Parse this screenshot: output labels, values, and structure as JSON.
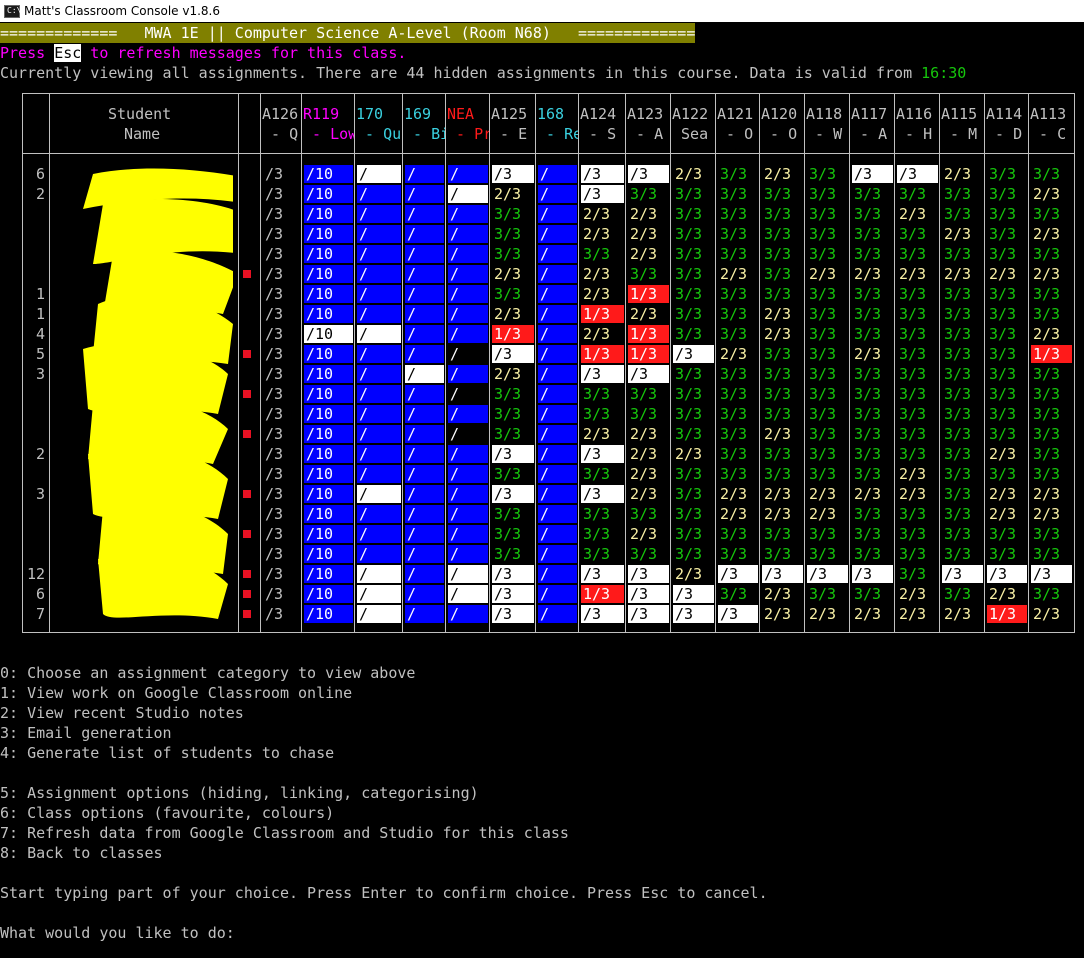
{
  "window": {
    "title": "Matt's Classroom Console v1.8.6",
    "icon_name": "terminal-icon",
    "icon_text": "C:\\"
  },
  "banner": "=============   MWA 1E || Computer Science A-Level (Room N68)   =============",
  "refresh_hint": {
    "before": "Press ",
    "key": "Esc",
    "after": " to refresh messages for this class."
  },
  "status": {
    "text": "Currently viewing all assignments. There are 44 hidden assignments in this course. Data is valid from ",
    "time": "16:30"
  },
  "colors": {
    "blue": "#0000ff",
    "red": "#ff1a1a",
    "white": "#ffffff",
    "yellow": "#f9f1a5",
    "green": "#16c60c",
    "cyan": "#3ad1e0",
    "magenta": "#ff00ff",
    "gray": "#c0c0c0",
    "olive": "#808000"
  },
  "table": {
    "student_header": [
      "Student",
      "Name"
    ],
    "columns": [
      {
        "l1": "A126",
        "l2": " - Q",
        "color": "gray"
      },
      {
        "l1": "R119",
        "l2": " - Low",
        "color": "magenta"
      },
      {
        "l1": "170",
        "l2": " - Qu",
        "color": "cyan"
      },
      {
        "l1": "169",
        "l2": " - Bi",
        "color": "cyan"
      },
      {
        "l1": "NEA",
        "l2": " - Pr",
        "color": "red"
      },
      {
        "l1": "A125",
        "l2": " - E",
        "color": "gray"
      },
      {
        "l1": "168",
        "l2": " - Re",
        "color": "cyan"
      },
      {
        "l1": "A124",
        "l2": " - S",
        "color": "gray"
      },
      {
        "l1": "A123",
        "l2": " - A",
        "color": "gray"
      },
      {
        "l1": "A122",
        "l2": " Sea",
        "color": "gray"
      },
      {
        "l1": "A121",
        "l2": " - O",
        "color": "gray"
      },
      {
        "l1": "A120",
        "l2": " - O",
        "color": "gray"
      },
      {
        "l1": "A118",
        "l2": " - W",
        "color": "gray"
      },
      {
        "l1": "A117",
        "l2": " - A",
        "color": "gray"
      },
      {
        "l1": "A116",
        "l2": " - H",
        "color": "gray"
      },
      {
        "l1": "A115",
        "l2": " - M",
        "color": "gray"
      },
      {
        "l1": "A114",
        "l2": " - D",
        "color": "gray"
      },
      {
        "l1": "A113",
        "l2": " - C",
        "color": "gray"
      }
    ],
    "rows": [
      {
        "count": "6",
        "flag": false,
        "cells": [
          "/3",
          "b:/10",
          "W:/",
          "b:/",
          "b:/",
          "W:/3",
          "b:/",
          "W:/3",
          "W:/3",
          "Y:2/3",
          "G:3/3",
          "Y:2/3",
          "G:3/3",
          "W:/3",
          "W:/3",
          "Y:2/3",
          "G:3/3",
          "G:3/3"
        ]
      },
      {
        "count": "2",
        "flag": false,
        "cells": [
          "/3",
          "b:/10",
          "b:/",
          "b:/",
          "W:/",
          "Y:2/3",
          "b:/",
          "W:/3",
          "G:3/3",
          "G:3/3",
          "G:3/3",
          "G:3/3",
          "G:3/3",
          "G:3/3",
          "G:3/3",
          "G:3/3",
          "G:3/3",
          "Y:2/3"
        ]
      },
      {
        "count": "",
        "flag": false,
        "cells": [
          "/3",
          "b:/10",
          "b:/",
          "b:/",
          "b:/",
          "G:3/3",
          "b:/",
          "Y:2/3",
          "Y:2/3",
          "G:3/3",
          "G:3/3",
          "G:3/3",
          "G:3/3",
          "G:3/3",
          "Y:2/3",
          "G:3/3",
          "G:3/3",
          "G:3/3"
        ]
      },
      {
        "count": "",
        "flag": false,
        "cells": [
          "/3",
          "b:/10",
          "b:/",
          "b:/",
          "b:/",
          "G:3/3",
          "b:/",
          "Y:2/3",
          "Y:2/3",
          "G:3/3",
          "G:3/3",
          "G:3/3",
          "G:3/3",
          "G:3/3",
          "G:3/3",
          "Y:2/3",
          "G:3/3",
          "Y:2/3"
        ]
      },
      {
        "count": "",
        "flag": false,
        "cells": [
          "/3",
          "b:/10",
          "b:/",
          "b:/",
          "b:/",
          "G:3/3",
          "b:/",
          "G:3/3",
          "Y:2/3",
          "G:3/3",
          "G:3/3",
          "G:3/3",
          "G:3/3",
          "G:3/3",
          "G:3/3",
          "G:3/3",
          "G:3/3",
          "G:3/3"
        ]
      },
      {
        "count": "",
        "flag": true,
        "cells": [
          "/3",
          "b:/10",
          "b:/",
          "b:/",
          "b:/",
          "Y:2/3",
          "b:/",
          "Y:2/3",
          "G:3/3",
          "G:3/3",
          "Y:2/3",
          "G:3/3",
          "Y:2/3",
          "Y:2/3",
          "Y:2/3",
          "Y:2/3",
          "Y:2/3",
          "Y:2/3"
        ]
      },
      {
        "count": "1",
        "flag": false,
        "cells": [
          "/3",
          "b:/10",
          "b:/",
          "b:/",
          "b:/",
          "G:3/3",
          "b:/",
          "Y:2/3",
          "R:1/3",
          "G:3/3",
          "G:3/3",
          "G:3/3",
          "G:3/3",
          "G:3/3",
          "G:3/3",
          "G:3/3",
          "G:3/3",
          "G:3/3"
        ]
      },
      {
        "count": "1",
        "flag": false,
        "cells": [
          "/3",
          "b:/10",
          "b:/",
          "b:/",
          "b:/",
          "Y:2/3",
          "b:/",
          "R:1/3",
          "Y:2/3",
          "G:3/3",
          "G:3/3",
          "Y:2/3",
          "G:3/3",
          "G:3/3",
          "G:3/3",
          "G:3/3",
          "G:3/3",
          "G:3/3"
        ]
      },
      {
        "count": "4",
        "flag": false,
        "cells": [
          "/3",
          "W:/10",
          "W:/",
          "b:/",
          "b:/",
          "R:1/3",
          "b:/",
          "Y:2/3",
          "R:1/3",
          "G:3/3",
          "G:3/3",
          "Y:2/3",
          "G:3/3",
          "G:3/3",
          "G:3/3",
          "G:3/3",
          "G:3/3",
          "Y:2/3"
        ]
      },
      {
        "count": "5",
        "flag": true,
        "cells": [
          "/3",
          "b:/10",
          "b:/",
          "b:/",
          "k:/",
          "W:/3",
          "b:/",
          "R:1/3",
          "R:1/3",
          "W:/3",
          "Y:2/3",
          "G:3/3",
          "G:3/3",
          "Y:2/3",
          "G:3/3",
          "G:3/3",
          "G:3/3",
          "R:1/3"
        ]
      },
      {
        "count": "3",
        "flag": false,
        "cells": [
          "/3",
          "b:/10",
          "b:/",
          "W:/",
          "b:/",
          "Y:2/3",
          "b:/",
          "W:/3",
          "W:/3",
          "G:3/3",
          "G:3/3",
          "G:3/3",
          "G:3/3",
          "G:3/3",
          "G:3/3",
          "G:3/3",
          "G:3/3",
          "G:3/3"
        ]
      },
      {
        "count": "",
        "flag": true,
        "cells": [
          "/3",
          "b:/10",
          "b:/",
          "b:/",
          "k:/",
          "G:3/3",
          "b:/",
          "G:3/3",
          "G:3/3",
          "G:3/3",
          "G:3/3",
          "G:3/3",
          "G:3/3",
          "G:3/3",
          "G:3/3",
          "G:3/3",
          "G:3/3",
          "G:3/3"
        ]
      },
      {
        "count": "",
        "flag": false,
        "cells": [
          "/3",
          "b:/10",
          "b:/",
          "b:/",
          "b:/",
          "G:3/3",
          "b:/",
          "G:3/3",
          "G:3/3",
          "G:3/3",
          "G:3/3",
          "G:3/3",
          "G:3/3",
          "G:3/3",
          "G:3/3",
          "G:3/3",
          "G:3/3",
          "G:3/3"
        ]
      },
      {
        "count": "",
        "flag": true,
        "cells": [
          "/3",
          "b:/10",
          "b:/",
          "b:/",
          "k:/",
          "G:3/3",
          "b:/",
          "Y:2/3",
          "Y:2/3",
          "G:3/3",
          "G:3/3",
          "Y:2/3",
          "G:3/3",
          "G:3/3",
          "G:3/3",
          "G:3/3",
          "G:3/3",
          "G:3/3"
        ]
      },
      {
        "count": "2",
        "flag": false,
        "cells": [
          "/3",
          "b:/10",
          "b:/",
          "b:/",
          "b:/",
          "W:/3",
          "b:/",
          "W:/3",
          "Y:2/3",
          "Y:2/3",
          "G:3/3",
          "G:3/3",
          "G:3/3",
          "G:3/3",
          "G:3/3",
          "G:3/3",
          "Y:2/3",
          "G:3/3"
        ]
      },
      {
        "count": "",
        "flag": false,
        "cells": [
          "/3",
          "b:/10",
          "b:/",
          "b:/",
          "b:/",
          "G:3/3",
          "b:/",
          "G:3/3",
          "Y:2/3",
          "G:3/3",
          "G:3/3",
          "G:3/3",
          "G:3/3",
          "G:3/3",
          "Y:2/3",
          "G:3/3",
          "G:3/3",
          "G:3/3"
        ]
      },
      {
        "count": "3",
        "flag": true,
        "cells": [
          "/3",
          "b:/10",
          "W:/",
          "b:/",
          "b:/",
          "W:/3",
          "b:/",
          "W:/3",
          "Y:2/3",
          "G:3/3",
          "Y:2/3",
          "Y:2/3",
          "Y:2/3",
          "Y:2/3",
          "Y:2/3",
          "G:3/3",
          "Y:2/3",
          "Y:2/3"
        ]
      },
      {
        "count": "",
        "flag": false,
        "cells": [
          "/3",
          "b:/10",
          "b:/",
          "b:/",
          "b:/",
          "G:3/3",
          "b:/",
          "G:3/3",
          "G:3/3",
          "G:3/3",
          "Y:2/3",
          "Y:2/3",
          "Y:2/3",
          "G:3/3",
          "G:3/3",
          "G:3/3",
          "Y:2/3",
          "Y:2/3"
        ]
      },
      {
        "count": "",
        "flag": true,
        "cells": [
          "/3",
          "b:/10",
          "b:/",
          "b:/",
          "b:/",
          "G:3/3",
          "b:/",
          "G:3/3",
          "Y:2/3",
          "G:3/3",
          "G:3/3",
          "G:3/3",
          "G:3/3",
          "G:3/3",
          "G:3/3",
          "G:3/3",
          "G:3/3",
          "G:3/3"
        ]
      },
      {
        "count": "",
        "flag": false,
        "cells": [
          "/3",
          "b:/10",
          "b:/",
          "b:/",
          "b:/",
          "G:3/3",
          "b:/",
          "G:3/3",
          "G:3/3",
          "G:3/3",
          "G:3/3",
          "G:3/3",
          "G:3/3",
          "G:3/3",
          "G:3/3",
          "G:3/3",
          "G:3/3",
          "G:3/3"
        ]
      },
      {
        "count": "12",
        "flag": true,
        "cells": [
          "/3",
          "b:/10",
          "W:/",
          "b:/",
          "W:/",
          "W:/3",
          "b:/",
          "W:/3",
          "W:/3",
          "Y:2/3",
          "W:/3",
          "W:/3",
          "W:/3",
          "W:/3",
          "G:3/3",
          "W:/3",
          "W:/3",
          "W:/3"
        ]
      },
      {
        "count": "6",
        "flag": true,
        "cells": [
          "/3",
          "b:/10",
          "W:/",
          "b:/",
          "W:/",
          "W:/3",
          "b:/",
          "R:1/3",
          "W:/3",
          "W:/3",
          "G:3/3",
          "Y:2/3",
          "G:3/3",
          "G:3/3",
          "Y:2/3",
          "G:3/3",
          "Y:2/3",
          "G:3/3"
        ]
      },
      {
        "count": "7",
        "flag": true,
        "cells": [
          "/3",
          "b:/10",
          "W:/",
          "b:/",
          "b:/",
          "W:/3",
          "b:/",
          "W:/3",
          "W:/3",
          "W:/3",
          "W:/3",
          "Y:2/3",
          "Y:2/3",
          "Y:2/3",
          "Y:2/3",
          "Y:2/3",
          "R:1/3",
          "Y:2/3"
        ]
      }
    ]
  },
  "menu": [
    "0: Choose an assignment category to view above",
    "1: View work on Google Classroom online",
    "2: View recent Studio notes",
    "3: Email generation",
    "4: Generate list of students to chase",
    "",
    "5: Assignment options (hiding, linking, categorising)",
    "6: Class options (favourite, colours)",
    "7: Refresh data from Google Classroom and Studio for this class",
    "8: Back to classes"
  ],
  "instructions": "Start typing part of your choice. Press Enter to confirm choice. Press Esc to cancel.",
  "prompt": "What would you like to do:"
}
